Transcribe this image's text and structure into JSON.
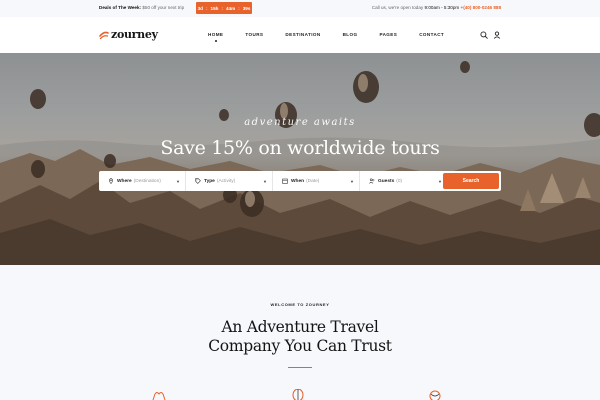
{
  "topbar": {
    "deal_label": "Deals of The Week:",
    "deal_text": "$50 off your next trip",
    "countdown": [
      "3d",
      "15h",
      "44m",
      "39s"
    ],
    "call_text": "Call us, we're open today",
    "hours": "9:00am - 5:30pm",
    "phone": "+(40) 800-0246 888"
  },
  "header": {
    "logo": "zourney",
    "nav": [
      "HOME",
      "TOURS",
      "DESTINATION",
      "BLOG",
      "PAGES",
      "CONTACT"
    ],
    "active_nav": "HOME",
    "icons": [
      "search-icon",
      "user-icon"
    ]
  },
  "hero": {
    "script_text": "adventure awaits",
    "headline": "Save 15% on worldwide tours",
    "search": {
      "fields": [
        {
          "label": "Where",
          "placeholder": "(Destination)",
          "icon": "location-pin-icon"
        },
        {
          "label": "Type",
          "placeholder": "(Activity)",
          "icon": "tag-icon"
        },
        {
          "label": "When",
          "placeholder": "(Date)",
          "icon": "calendar-icon"
        },
        {
          "label": "Guests",
          "placeholder": "(0)",
          "icon": "guests-icon"
        }
      ],
      "button": "Search"
    }
  },
  "intro": {
    "kicker": "WELCOME TO ZOURNEY",
    "title_line1": "An Adventure Travel",
    "title_line2": "Company You Can Trust"
  },
  "colors": {
    "accent": "#e8622c",
    "text": "#1b1b1b",
    "background": "#f7f8fb"
  }
}
